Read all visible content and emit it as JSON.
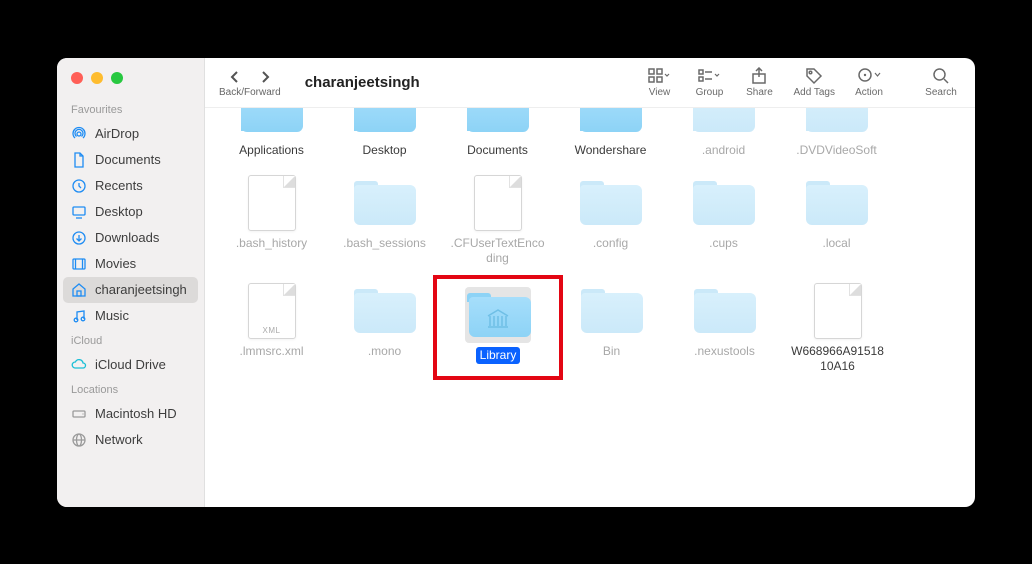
{
  "title": "charanjeetsingh",
  "nav_label": "Back/Forward",
  "toolbar": [
    {
      "id": "view",
      "label": "View"
    },
    {
      "id": "group",
      "label": "Group"
    },
    {
      "id": "share",
      "label": "Share"
    },
    {
      "id": "add-tags",
      "label": "Add Tags"
    },
    {
      "id": "action",
      "label": "Action"
    },
    {
      "id": "search",
      "label": "Search"
    }
  ],
  "sidebar": {
    "sections": [
      {
        "label": "Favourites",
        "items": [
          {
            "id": "airdrop",
            "label": "AirDrop"
          },
          {
            "id": "documents",
            "label": "Documents"
          },
          {
            "id": "recents",
            "label": "Recents"
          },
          {
            "id": "desktop",
            "label": "Desktop"
          },
          {
            "id": "downloads",
            "label": "Downloads"
          },
          {
            "id": "movies",
            "label": "Movies"
          },
          {
            "id": "home",
            "label": "charanjeetsingh",
            "selected": true
          },
          {
            "id": "music",
            "label": "Music"
          }
        ]
      },
      {
        "label": "iCloud",
        "items": [
          {
            "id": "icloud-drive",
            "label": "iCloud Drive"
          }
        ]
      },
      {
        "label": "Locations",
        "items": [
          {
            "id": "macintosh-hd",
            "label": "Macintosh HD"
          },
          {
            "id": "network",
            "label": "Network"
          }
        ]
      }
    ]
  },
  "items": [
    {
      "name": "Applications",
      "type": "folder",
      "cut": true
    },
    {
      "name": "Desktop",
      "type": "folder",
      "cut": true
    },
    {
      "name": "Documents",
      "type": "folder",
      "cut": true
    },
    {
      "name": "Wondershare",
      "type": "folder",
      "cut": true
    },
    {
      "name": ".android",
      "type": "folder",
      "dim": true,
      "ghost": true,
      "cut": true
    },
    {
      "name": ".DVDVideoSoft",
      "type": "folder",
      "dim": true,
      "ghost": true,
      "cut": true
    },
    {
      "name": ".bash_history",
      "type": "file",
      "dim": true
    },
    {
      "name": ".bash_sessions",
      "type": "folder",
      "dim": true,
      "ghost": true
    },
    {
      "name": ".CFUserTextEncoding",
      "type": "file",
      "dim": true
    },
    {
      "name": ".config",
      "type": "folder",
      "dim": true,
      "ghost": true
    },
    {
      "name": ".cups",
      "type": "folder",
      "dim": true,
      "ghost": true
    },
    {
      "name": ".local",
      "type": "folder",
      "dim": true,
      "ghost": true
    },
    {
      "name": ".lmmsrc.xml",
      "type": "file",
      "dim": true,
      "tag": "XML"
    },
    {
      "name": ".mono",
      "type": "folder",
      "dim": true,
      "ghost": true
    },
    {
      "name": "Library",
      "type": "folder",
      "special": "library",
      "selected": true,
      "highlighted": true
    },
    {
      "name": "Bin",
      "type": "folder",
      "dim": true,
      "ghost": true
    },
    {
      "name": ".nexustools",
      "type": "folder",
      "dim": true,
      "ghost": true
    },
    {
      "name": "W668966A9151810A16",
      "type": "file"
    }
  ]
}
